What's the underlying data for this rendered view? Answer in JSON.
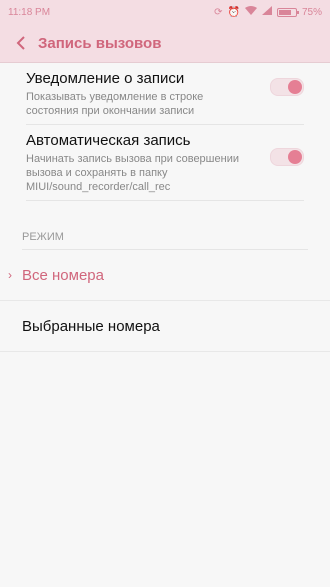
{
  "status": {
    "time": "11:18 PM",
    "battery": "75%",
    "battery_level": 0.75
  },
  "header": {
    "title": "Запись вызовов"
  },
  "settings": [
    {
      "title": "Уведомление о записи",
      "desc": "Показывать уведомление в строке состояния при окончании записи",
      "enabled": true
    },
    {
      "title": "Автоматическая запись",
      "desc": "Начинать запись вызова при совершении вызова и сохранять в папку MIUI/sound_recorder/call_rec",
      "enabled": true
    }
  ],
  "mode": {
    "label": "РЕЖИМ",
    "options": [
      {
        "label": "Все номера",
        "selected": true,
        "marker": "›"
      },
      {
        "label": "Выбранные номера",
        "selected": false
      }
    ]
  },
  "colors": {
    "accent": "#d0667c",
    "header_bg": "#f4dde3",
    "toggle_on": "#e57f94"
  }
}
